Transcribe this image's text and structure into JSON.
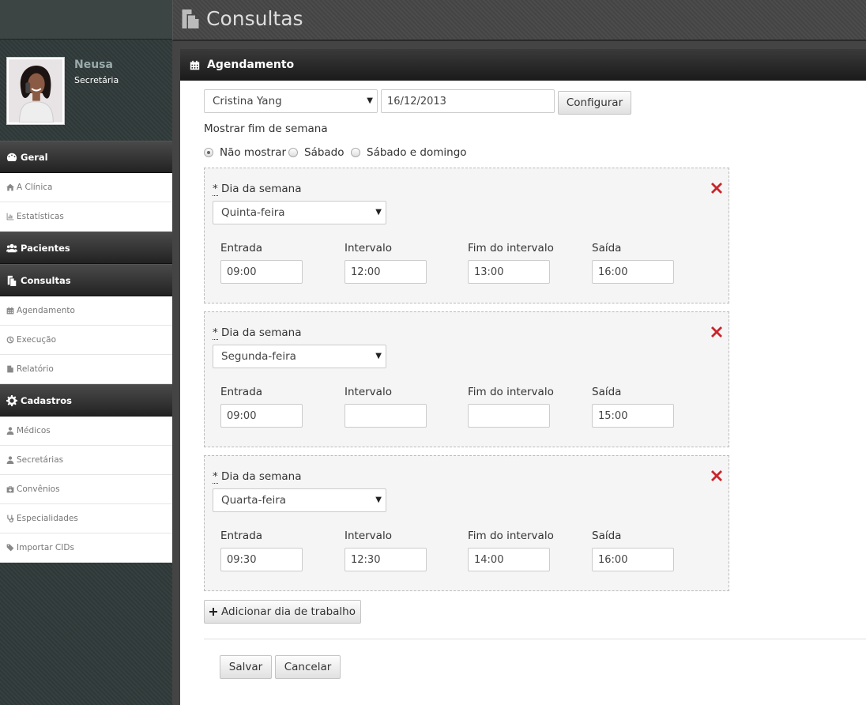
{
  "page": {
    "title": "Consultas"
  },
  "user": {
    "name": "Neusa",
    "role": "Secretária"
  },
  "nav": {
    "geral": {
      "label": "Geral",
      "items": [
        "A Clínica",
        "Estatísticas"
      ]
    },
    "pacientes": {
      "label": "Pacientes"
    },
    "consultas": {
      "label": "Consultas",
      "items": [
        "Agendamento",
        "Execução",
        "Relatório"
      ]
    },
    "cadastros": {
      "label": "Cadastros",
      "items": [
        "Médicos",
        "Secretárias",
        "Convênios",
        "Especialidades",
        "Importar CIDs"
      ]
    }
  },
  "panel": {
    "title": "Agendamento"
  },
  "form": {
    "doctor": "Cristina Yang",
    "date": "16/12/2013",
    "configure_label": "Configurar",
    "weekend_label": "Mostrar fim de semana",
    "weekend_options": [
      "Não mostrar",
      "Sábado",
      "Sábado e domingo"
    ],
    "weekend_selected": "Não mostrar",
    "day_label": "Dia da semana",
    "required_mark": "*",
    "col_labels": {
      "entrada": "Entrada",
      "intervalo": "Intervalo",
      "fim_intervalo": "Fim do intervalo",
      "saida": "Saída"
    },
    "days": [
      {
        "day": "Quinta-feira",
        "entrada": "09:00",
        "intervalo": "12:00",
        "fim_intervalo": "13:00",
        "saida": "16:00"
      },
      {
        "day": "Segunda-feira",
        "entrada": "09:00",
        "intervalo": "",
        "fim_intervalo": "",
        "saida": "15:00"
      },
      {
        "day": "Quarta-feira",
        "entrada": "09:30",
        "intervalo": "12:30",
        "fim_intervalo": "14:00",
        "saida": "16:00"
      }
    ],
    "add_label": "Adicionar dia de trabalho",
    "save_label": "Salvar",
    "cancel_label": "Cancelar"
  },
  "colors": {
    "delete": "#c9252c",
    "header": "#222222"
  }
}
